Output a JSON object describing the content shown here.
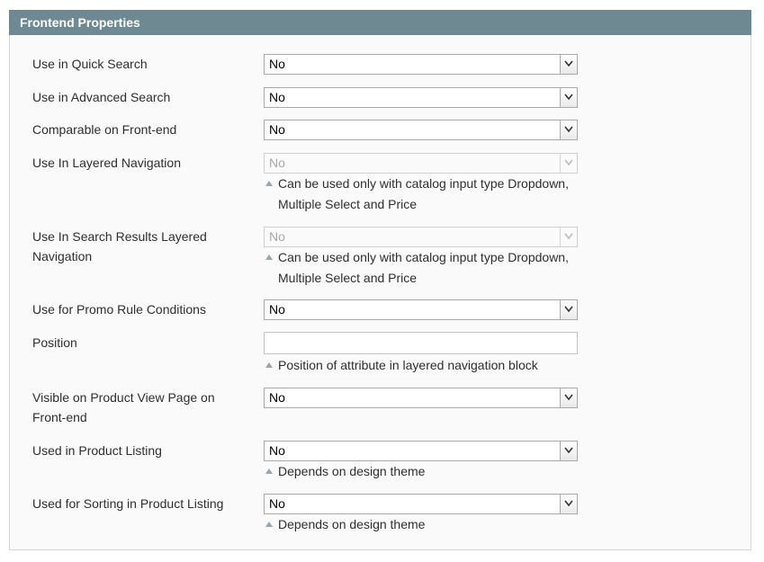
{
  "section": {
    "title": "Frontend Properties"
  },
  "fields": {
    "quick_search": {
      "label": "Use in Quick Search",
      "value": "No"
    },
    "advanced_search": {
      "label": "Use in Advanced Search",
      "value": "No"
    },
    "comparable": {
      "label": "Comparable on Front-end",
      "value": "No"
    },
    "layered_nav": {
      "label": "Use In Layered Navigation",
      "value": "No",
      "note": "Can be used only with catalog input type Dropdown, Multiple Select and Price"
    },
    "search_layered_nav": {
      "label": "Use In Search Results Layered Navigation",
      "value": "No",
      "note": "Can be used only with catalog input type Dropdown, Multiple Select and Price"
    },
    "promo_rule": {
      "label": "Use for Promo Rule Conditions",
      "value": "No"
    },
    "position": {
      "label": "Position",
      "value": "",
      "note": "Position of attribute in layered navigation block"
    },
    "visible_product_view": {
      "label": "Visible on Product View Page on Front-end",
      "value": "No"
    },
    "product_listing": {
      "label": "Used in Product Listing",
      "value": "No",
      "note": "Depends on design theme"
    },
    "sorting_listing": {
      "label": "Used for Sorting in Product Listing",
      "value": "No",
      "note": "Depends on design theme"
    }
  },
  "icons": {
    "dropdown": "chevron-down-icon",
    "note": "triangle-up-icon"
  },
  "colors": {
    "header_bg": "#6f8992",
    "panel_bg": "#fafafa"
  }
}
